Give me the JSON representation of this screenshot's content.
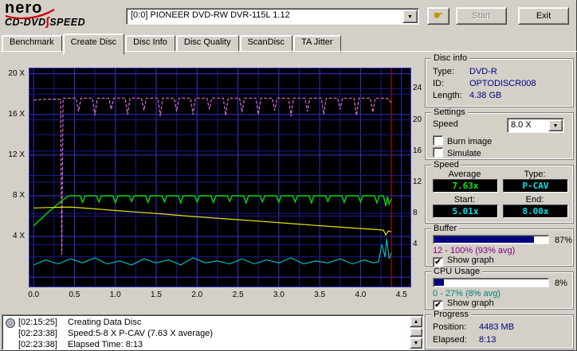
{
  "logo": {
    "brand": "nero",
    "line2_left": "CD-DVD",
    "swoosh": "∫",
    "line2_right": "SPEED"
  },
  "header": {
    "device": "[0:0]   PIONEER DVD-RW  DVR-115L 1.12",
    "hand_icon": "☛",
    "start_label": "Start",
    "exit_label": "Exit"
  },
  "tabs": [
    {
      "label": "Benchmark"
    },
    {
      "label": "Create Disc"
    },
    {
      "label": "Disc Info"
    },
    {
      "label": "Disc Quality"
    },
    {
      "label": "ScanDisc"
    },
    {
      "label": "TA Jitter"
    }
  ],
  "chart_data": {
    "type": "line",
    "x_axis": {
      "min": -0.06,
      "max": 4.62,
      "ticks": [
        {
          "v": 0,
          "label": "0.0"
        },
        {
          "v": 0.5,
          "label": "0.5"
        },
        {
          "v": 1.0,
          "label": "1.0"
        },
        {
          "v": 1.5,
          "label": "1.5"
        },
        {
          "v": 2.0,
          "label": "2.0"
        },
        {
          "v": 2.5,
          "label": "2.5"
        },
        {
          "v": 3.0,
          "label": "3.0"
        },
        {
          "v": 3.5,
          "label": "3.5"
        },
        {
          "v": 4.0,
          "label": "4.0"
        },
        {
          "v": 4.5,
          "label": "4.5"
        }
      ],
      "minor_step": 0.25
    },
    "y_left": {
      "min": -1.0,
      "max": 20.6,
      "grid_step": 2,
      "ticks": [
        {
          "v": 20,
          "label": "20 X"
        },
        {
          "v": 16,
          "label": "16 X"
        },
        {
          "v": 12,
          "label": "12 X"
        },
        {
          "v": 8,
          "label": "8 X"
        },
        {
          "v": 4,
          "label": "4 X"
        }
      ]
    },
    "y_right": {
      "min": -1.5,
      "max": 26.7,
      "grid_step": 4,
      "ticks": [
        {
          "v": 24,
          "label": "24"
        },
        {
          "v": 20,
          "label": "20"
        },
        {
          "v": 16,
          "label": "16"
        },
        {
          "v": 12,
          "label": "12"
        },
        {
          "v": 8,
          "label": "8"
        },
        {
          "v": 4,
          "label": "4"
        }
      ]
    },
    "bg": "#000000",
    "grid_major": "#3434cf",
    "grid_minor": "#1a1a8e",
    "frame": "#3434cf",
    "end_marker_x": 4.38,
    "end_marker_color": "#b00000",
    "series": [
      {
        "name": "buffer-level",
        "color": "#d26fd2",
        "dash": "4 2",
        "width": 1.2,
        "points": [
          [
            0,
            17.4
          ],
          [
            0.15,
            17.5
          ],
          [
            0.3,
            17.5
          ],
          [
            0.33,
            17.5
          ],
          [
            0.345,
            2.2
          ],
          [
            0.36,
            17.6
          ],
          [
            0.52,
            17.6
          ],
          [
            0.55,
            16.3
          ],
          [
            0.58,
            17.6
          ],
          [
            0.72,
            17.6
          ],
          [
            0.75,
            15.9
          ],
          [
            0.78,
            17.6
          ],
          [
            0.92,
            17.6
          ],
          [
            0.95,
            16.5
          ],
          [
            0.98,
            17.6
          ],
          [
            1.12,
            17.6
          ],
          [
            1.15,
            16.0
          ],
          [
            1.18,
            17.6
          ],
          [
            1.32,
            17.6
          ],
          [
            1.35,
            16.4
          ],
          [
            1.38,
            17.6
          ],
          [
            1.52,
            17.6
          ],
          [
            1.55,
            15.8
          ],
          [
            1.58,
            17.6
          ],
          [
            1.72,
            17.6
          ],
          [
            1.75,
            16.3
          ],
          [
            1.78,
            17.6
          ],
          [
            1.92,
            17.6
          ],
          [
            1.95,
            16.0
          ],
          [
            1.98,
            17.6
          ],
          [
            2.12,
            17.6
          ],
          [
            2.15,
            16.5
          ],
          [
            2.18,
            17.6
          ],
          [
            2.32,
            17.6
          ],
          [
            2.35,
            15.9
          ],
          [
            2.38,
            17.6
          ],
          [
            2.52,
            17.6
          ],
          [
            2.55,
            16.2
          ],
          [
            2.58,
            17.6
          ],
          [
            2.72,
            17.6
          ],
          [
            2.75,
            16.0
          ],
          [
            2.78,
            17.6
          ],
          [
            2.92,
            17.6
          ],
          [
            2.95,
            16.4
          ],
          [
            2.98,
            17.6
          ],
          [
            3.12,
            17.6
          ],
          [
            3.15,
            15.8
          ],
          [
            3.18,
            17.6
          ],
          [
            3.32,
            17.6
          ],
          [
            3.35,
            16.3
          ],
          [
            3.38,
            17.6
          ],
          [
            3.52,
            17.6
          ],
          [
            3.55,
            16.0
          ],
          [
            3.58,
            17.6
          ],
          [
            3.72,
            17.6
          ],
          [
            3.75,
            16.5
          ],
          [
            3.78,
            17.6
          ],
          [
            3.92,
            17.6
          ],
          [
            3.95,
            15.9
          ],
          [
            3.98,
            17.6
          ],
          [
            4.12,
            17.6
          ],
          [
            4.15,
            16.2
          ],
          [
            4.18,
            17.6
          ],
          [
            4.3,
            17.6
          ],
          [
            4.35,
            17.5
          ],
          [
            4.38,
            17.0
          ]
        ]
      },
      {
        "name": "write-speed",
        "color": "#00dd00",
        "dash": "",
        "width": 1.4,
        "points": [
          [
            0,
            5.05
          ],
          [
            0.06,
            5.5
          ],
          [
            0.12,
            5.95
          ],
          [
            0.18,
            6.4
          ],
          [
            0.24,
            6.8
          ],
          [
            0.3,
            7.2
          ],
          [
            0.36,
            7.6
          ],
          [
            0.42,
            7.95
          ],
          [
            0.45,
            8
          ],
          [
            0.57,
            8
          ],
          [
            0.6,
            7.35
          ],
          [
            0.63,
            8
          ],
          [
            0.77,
            8
          ],
          [
            0.8,
            7.4
          ],
          [
            0.83,
            8
          ],
          [
            0.97,
            8
          ],
          [
            1.0,
            7.3
          ],
          [
            1.03,
            8
          ],
          [
            1.17,
            8
          ],
          [
            1.2,
            7.45
          ],
          [
            1.23,
            8
          ],
          [
            1.37,
            8
          ],
          [
            1.4,
            7.35
          ],
          [
            1.43,
            8
          ],
          [
            1.57,
            8
          ],
          [
            1.6,
            7.4
          ],
          [
            1.63,
            8
          ],
          [
            1.77,
            8
          ],
          [
            1.8,
            7.3
          ],
          [
            1.83,
            8
          ],
          [
            1.97,
            8
          ],
          [
            2.0,
            7.4
          ],
          [
            2.03,
            8
          ],
          [
            2.17,
            8
          ],
          [
            2.2,
            7.35
          ],
          [
            2.23,
            8
          ],
          [
            2.37,
            8
          ],
          [
            2.4,
            7.45
          ],
          [
            2.43,
            8
          ],
          [
            2.57,
            8
          ],
          [
            2.6,
            7.3
          ],
          [
            2.63,
            8
          ],
          [
            2.77,
            8
          ],
          [
            2.8,
            7.4
          ],
          [
            2.83,
            8
          ],
          [
            2.97,
            8
          ],
          [
            3.0,
            7.35
          ],
          [
            3.03,
            8
          ],
          [
            3.17,
            8
          ],
          [
            3.2,
            7.4
          ],
          [
            3.23,
            8
          ],
          [
            3.37,
            8
          ],
          [
            3.4,
            7.3
          ],
          [
            3.43,
            8
          ],
          [
            3.57,
            8
          ],
          [
            3.6,
            7.45
          ],
          [
            3.63,
            8
          ],
          [
            3.77,
            8
          ],
          [
            3.8,
            7.35
          ],
          [
            3.83,
            8
          ],
          [
            3.97,
            8
          ],
          [
            4.0,
            7.4
          ],
          [
            4.03,
            8
          ],
          [
            4.17,
            8
          ],
          [
            4.2,
            7.3
          ],
          [
            4.23,
            8
          ],
          [
            4.28,
            8
          ],
          [
            4.31,
            7.0
          ],
          [
            4.33,
            7.9
          ],
          [
            4.35,
            7.2
          ],
          [
            4.38,
            7.8
          ]
        ]
      },
      {
        "name": "rotation-speed",
        "color": "#e6e600",
        "dash": "",
        "width": 1.2,
        "points": [
          [
            0,
            6.8
          ],
          [
            0.2,
            6.85
          ],
          [
            0.45,
            6.9
          ],
          [
            0.7,
            6.75
          ],
          [
            1.0,
            6.55
          ],
          [
            1.3,
            6.38
          ],
          [
            1.6,
            6.2
          ],
          [
            1.9,
            6.0
          ],
          [
            2.2,
            5.82
          ],
          [
            2.5,
            5.65
          ],
          [
            2.8,
            5.48
          ],
          [
            3.1,
            5.3
          ],
          [
            3.4,
            5.12
          ],
          [
            3.7,
            4.95
          ],
          [
            4.0,
            4.78
          ],
          [
            4.2,
            4.68
          ],
          [
            4.28,
            4.62
          ],
          [
            4.31,
            4.15
          ],
          [
            4.34,
            4.55
          ],
          [
            4.38,
            4.45
          ]
        ]
      },
      {
        "name": "cpu-usage",
        "color": "#00c8c8",
        "dash": "",
        "width": 1.1,
        "points": [
          [
            0,
            1.2
          ],
          [
            0.15,
            1.7
          ],
          [
            0.3,
            1.3
          ],
          [
            0.45,
            1.8
          ],
          [
            0.6,
            1.4
          ],
          [
            0.75,
            1.9
          ],
          [
            0.9,
            1.3
          ],
          [
            1.05,
            1.6
          ],
          [
            1.2,
            1.2
          ],
          [
            1.35,
            1.8
          ],
          [
            1.5,
            1.4
          ],
          [
            1.65,
            1.7
          ],
          [
            1.8,
            1.2
          ],
          [
            1.95,
            1.9
          ],
          [
            2.1,
            1.4
          ],
          [
            2.25,
            1.6
          ],
          [
            2.4,
            1.3
          ],
          [
            2.55,
            1.8
          ],
          [
            2.7,
            1.3
          ],
          [
            2.85,
            1.7
          ],
          [
            3.0,
            1.4
          ],
          [
            3.15,
            1.9
          ],
          [
            3.3,
            1.3
          ],
          [
            3.45,
            1.6
          ],
          [
            3.6,
            1.4
          ],
          [
            3.75,
            1.8
          ],
          [
            3.9,
            1.3
          ],
          [
            4.05,
            1.7
          ],
          [
            4.15,
            1.4
          ],
          [
            4.22,
            1.5
          ],
          [
            4.26,
            3.2
          ],
          [
            4.3,
            2.0
          ],
          [
            4.32,
            3.8
          ],
          [
            4.35,
            1.8
          ],
          [
            4.38,
            2.5
          ]
        ]
      }
    ]
  },
  "sidebar": {
    "disc_info": {
      "title": "Disc info",
      "rows": [
        {
          "label": "Type:",
          "value": "DVD-R"
        },
        {
          "label": "ID:",
          "value": "OPTODISCR008"
        },
        {
          "label": "Length:",
          "value": "4.38 GB"
        }
      ]
    },
    "settings": {
      "title": "Settings",
      "speed_label": "Speed",
      "speed_value": "8.0 X",
      "checkboxes": [
        {
          "label": "Burn image",
          "checked": false
        },
        {
          "label": "Simulate",
          "checked": false
        }
      ]
    },
    "speed": {
      "title": "Speed",
      "average_label": "Average",
      "average": "7.63x",
      "type_label": "Type:",
      "type": "P-CAV",
      "start_label": "Start:",
      "start": "5.01x",
      "end_label": "End:",
      "end": "8.00x"
    },
    "buffer": {
      "title": "Buffer",
      "percent": 87,
      "percent_label": "87%",
      "range_text": "12 - 100% (93% avg)",
      "show_graph_label": "Show graph",
      "show_graph_checked": true
    },
    "cpu": {
      "title": "CPU Usage",
      "percent": 8,
      "percent_label": "8%",
      "range_text": "0 - 27% (8% avg)",
      "show_graph_label": "Show graph",
      "show_graph_checked": true
    },
    "progress": {
      "title": "Progress",
      "position_label": "Position:",
      "position": "4483 MB",
      "elapsed_label": "Elapsed:",
      "elapsed": "8:13"
    }
  },
  "log": {
    "rows": [
      {
        "icon": true,
        "time": "[02:15:25]",
        "text": "Creating Data Disc"
      },
      {
        "icon": false,
        "time": "[02:23:38]",
        "text": "Speed:5-8 X P-CAV (7.63 X average)"
      },
      {
        "icon": false,
        "time": "[02:23:38]",
        "text": "Elapsed Time:  8:13"
      }
    ]
  }
}
